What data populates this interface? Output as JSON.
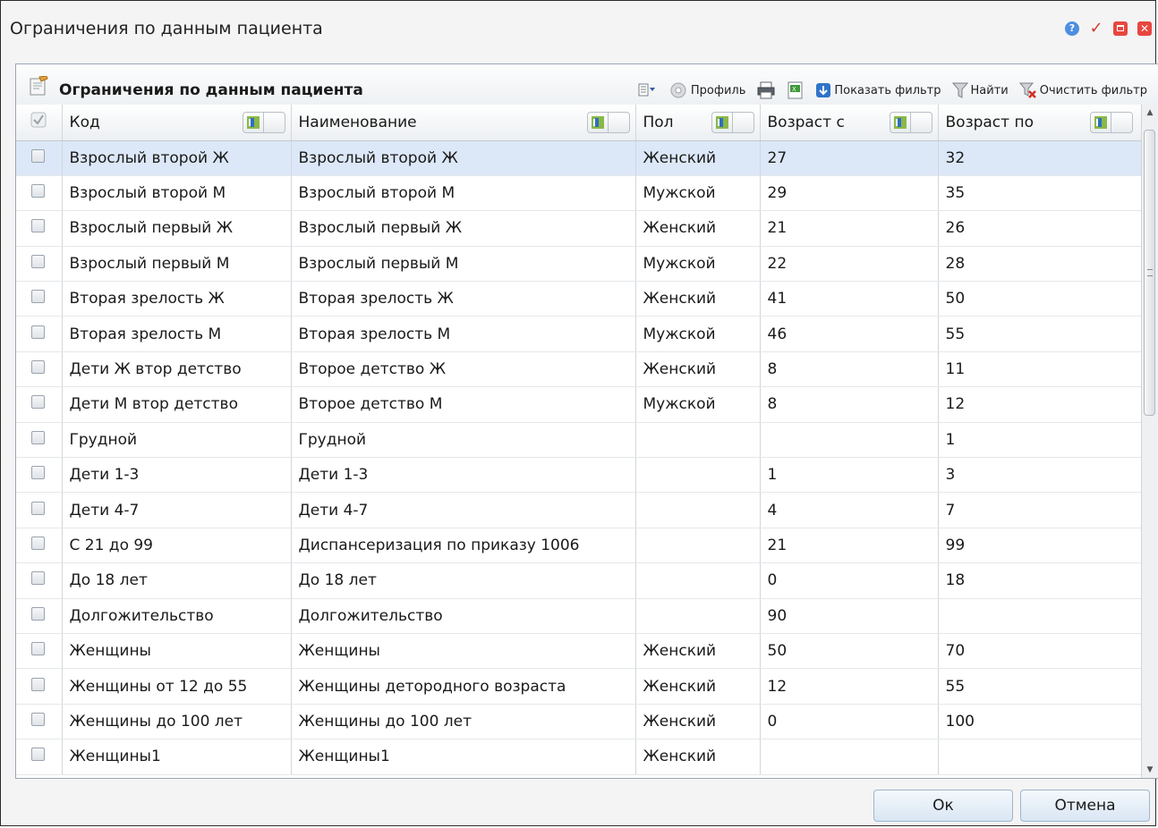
{
  "window": {
    "title": "Ограничения по данным пациента"
  },
  "toolbar": {
    "title": "Ограничения по данным пациента",
    "profile_label": "Профиль",
    "show_filter_label": "Показать фильтр",
    "find_label": "Найти",
    "clear_filter_label": "Очистить фильтр"
  },
  "table": {
    "columns": [
      "Код",
      "Наименование",
      "Пол",
      "Возраст с",
      "Возраст по"
    ],
    "rows": [
      {
        "code": "Взрослый второй Ж",
        "name": "Взрослый второй Ж",
        "sex": "Женский",
        "age_from": "27",
        "age_to": "32",
        "selected": true
      },
      {
        "code": "Взрослый второй М",
        "name": "Взрослый второй М",
        "sex": "Мужской",
        "age_from": "29",
        "age_to": "35"
      },
      {
        "code": "Взрослый первый Ж",
        "name": "Взрослый первый Ж",
        "sex": "Женский",
        "age_from": "21",
        "age_to": "26"
      },
      {
        "code": "Взрослый первый М",
        "name": "Взрослый первый М",
        "sex": "Мужской",
        "age_from": "22",
        "age_to": "28"
      },
      {
        "code": "Вторая зрелость Ж",
        "name": "Вторая зрелость Ж",
        "sex": "Женский",
        "age_from": "41",
        "age_to": "50"
      },
      {
        "code": "Вторая зрелость М",
        "name": "Вторая зрелость М",
        "sex": "Мужской",
        "age_from": "46",
        "age_to": "55"
      },
      {
        "code": "Дети Ж втор детство",
        "name": "Второе детство Ж",
        "sex": "Женский",
        "age_from": "8",
        "age_to": "11"
      },
      {
        "code": "Дети М втор детство",
        "name": "Второе детство М",
        "sex": "Мужской",
        "age_from": "8",
        "age_to": "12"
      },
      {
        "code": "Грудной",
        "name": "Грудной",
        "sex": "",
        "age_from": "",
        "age_to": "1"
      },
      {
        "code": "Дети 1-3",
        "name": "Дети 1-3",
        "sex": "",
        "age_from": "1",
        "age_to": "3"
      },
      {
        "code": "Дети 4-7",
        "name": "Дети 4-7",
        "sex": "",
        "age_from": "4",
        "age_to": "7"
      },
      {
        "code": "С 21 до 99",
        "name": "Диспансеризация по приказу 1006",
        "sex": "",
        "age_from": "21",
        "age_to": "99"
      },
      {
        "code": "До 18 лет",
        "name": "До 18 лет",
        "sex": "",
        "age_from": "0",
        "age_to": "18"
      },
      {
        "code": "Долгожительство",
        "name": "Долгожительство",
        "sex": "",
        "age_from": "90",
        "age_to": ""
      },
      {
        "code": "Женщины",
        "name": "Женщины",
        "sex": "Женский",
        "age_from": "50",
        "age_to": "70"
      },
      {
        "code": "Женщины от 12 до 55",
        "name": "Женщины детородного возраста",
        "sex": "Женский",
        "age_from": "12",
        "age_to": "55"
      },
      {
        "code": "Женщины до 100 лет",
        "name": "Женщины до 100 лет",
        "sex": "Женский",
        "age_from": "0",
        "age_to": "100"
      },
      {
        "code": "Женщины1",
        "name": "Женщины1",
        "sex": "Женский",
        "age_from": "",
        "age_to": ""
      }
    ]
  },
  "buttons": {
    "ok": "Ок",
    "cancel": "Отмена"
  },
  "colors": {
    "selected_row": "#dce8f7",
    "close_red": "#e7473f",
    "help_blue": "#4d8fe0"
  }
}
